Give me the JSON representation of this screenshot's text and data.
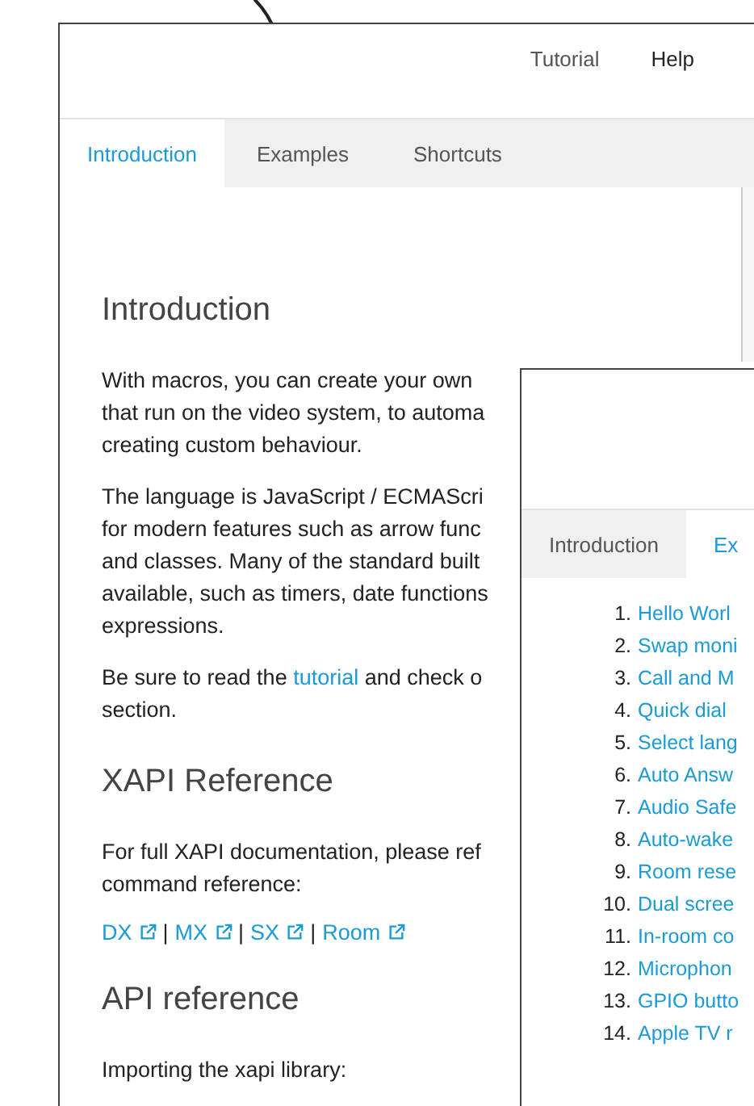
{
  "back_window": {
    "nav_links": [
      "Tutorial",
      "Help"
    ],
    "tabs": [
      {
        "label": "Introduction",
        "selected": true
      },
      {
        "label": "Examples",
        "selected": false
      },
      {
        "label": "Shortcuts",
        "selected": false
      }
    ],
    "sections": [
      {
        "heading": "Introduction",
        "blocks": [
          {
            "kind": "paragraph",
            "lines": [
              "With macros, you can create your own",
              "that run on the video system, to automa",
              "creating custom behaviour."
            ]
          },
          {
            "kind": "paragraph",
            "lines": [
              "The language is JavaScript / ECMAScri",
              "for modern features such as arrow func",
              "and classes. Many of the standard built",
              "available, such as timers, date functions",
              "expressions."
            ]
          },
          {
            "kind": "paragraph",
            "lines": [
              [
                {
                  "text": "Be sure to read the "
                },
                {
                  "text": "tutorial",
                  "link": true
                },
                {
                  "text": " and check o"
                }
              ],
              "section."
            ]
          }
        ]
      },
      {
        "heading": "XAPI Reference",
        "blocks": [
          {
            "kind": "paragraph",
            "lines": [
              "For full XAPI documentation, please ref",
              "command reference:"
            ]
          },
          {
            "kind": "links",
            "items": [
              "DX",
              "MX",
              "SX",
              "Room"
            ],
            "separator": "|"
          }
        ]
      },
      {
        "heading": "API reference",
        "blocks": [
          {
            "kind": "paragraph",
            "lines": [
              "Importing the xapi library:"
            ]
          }
        ]
      }
    ]
  },
  "front_window": {
    "tabs": [
      {
        "label": "Introduction",
        "selected": false
      },
      {
        "label": "Ex",
        "selected": true
      }
    ],
    "examples": [
      {
        "number": "1.",
        "title": "Hello Worl"
      },
      {
        "number": "2.",
        "title": "Swap moni"
      },
      {
        "number": "3.",
        "title": "Call and M"
      },
      {
        "number": "4.",
        "title": "Quick dial"
      },
      {
        "number": "5.",
        "title": "Select lang"
      },
      {
        "number": "6.",
        "title": "Auto Answ"
      },
      {
        "number": "7.",
        "title": "Audio Safe"
      },
      {
        "number": "8.",
        "title": "Auto-wake"
      },
      {
        "number": "9.",
        "title": "Room rese"
      },
      {
        "number": "10.",
        "title": "Dual scree"
      },
      {
        "number": "11.",
        "title": "In-room co"
      },
      {
        "number": "12.",
        "title": "Microphon"
      },
      {
        "number": "13.",
        "title": "GPIO butto"
      },
      {
        "number": "14.",
        "title": "Apple TV r"
      }
    ]
  }
}
